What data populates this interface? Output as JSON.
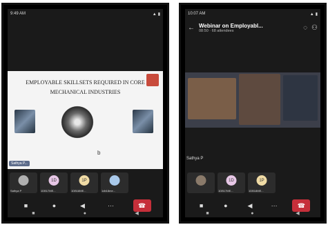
{
  "left": {
    "status_time": "9:49 AM",
    "slide": {
      "title_line1": "EMPLOYABLE SKILLSETS REQUIRED IN CORE",
      "title_line2": "MECHANICAL INDUSTRIES",
      "mark": "b"
    },
    "presenter_tag": "Sathya P...",
    "participants": [
      {
        "initials": "",
        "name": "Sathya P",
        "color": "#b0b0b0"
      },
      {
        "initials": "1D",
        "name": "1DB17ME...",
        "color": "#e7c7e6"
      },
      {
        "initials": "1P",
        "name": "1DB18ME...",
        "color": "#f0dba5"
      },
      {
        "initials": "",
        "name": "1db18me...",
        "color": "#a9c9ea"
      }
    ],
    "controls": [
      "video-icon",
      "mic-icon",
      "speaker-icon",
      "more-icon",
      "hangup-icon"
    ]
  },
  "right": {
    "status_time": "10:07 AM",
    "meeting_title": "Webinar on Employabl...",
    "meeting_sub": "08:50 · 68 attendees",
    "caption": "Sathya P",
    "participants": [
      {
        "initials": "",
        "name": "",
        "color": "#8a7a6a"
      },
      {
        "initials": "1D",
        "name": "1DB17ME...",
        "color": "#e7c7e6"
      },
      {
        "initials": "1P",
        "name": "1DB18ME...",
        "color": "#f0dba5"
      }
    ]
  }
}
